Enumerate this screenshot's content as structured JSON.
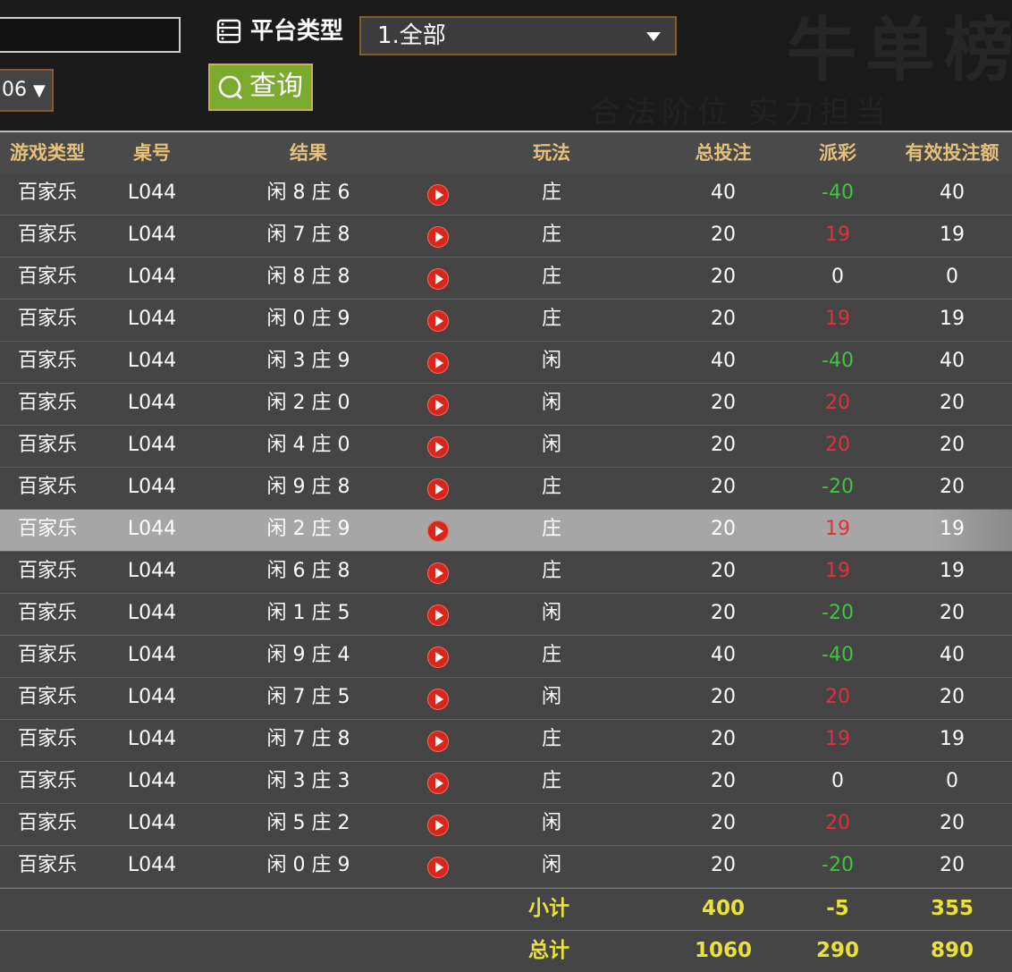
{
  "filters": {
    "date_select_value": "06",
    "platform_label": "平台类型",
    "platform_value": "1.全部",
    "query_label": "查询"
  },
  "table": {
    "headers": [
      "游戏类型",
      "桌号",
      "结果",
      "玩法",
      "总投注",
      "派彩",
      "有效投注额"
    ],
    "rows": [
      {
        "game": "百家乐",
        "table": "L044",
        "result": "闲 8 庄 6",
        "bet": "庄",
        "total": "40",
        "payout": "-40",
        "valid": "40",
        "sign": "neg"
      },
      {
        "game": "百家乐",
        "table": "L044",
        "result": "闲 7 庄 8",
        "bet": "庄",
        "total": "20",
        "payout": "19",
        "valid": "19",
        "sign": "pos"
      },
      {
        "game": "百家乐",
        "table": "L044",
        "result": "闲 8 庄 8",
        "bet": "庄",
        "total": "20",
        "payout": "0",
        "valid": "0",
        "sign": "zero"
      },
      {
        "game": "百家乐",
        "table": "L044",
        "result": "闲 0 庄 9",
        "bet": "庄",
        "total": "20",
        "payout": "19",
        "valid": "19",
        "sign": "pos"
      },
      {
        "game": "百家乐",
        "table": "L044",
        "result": "闲 3 庄 9",
        "bet": "闲",
        "total": "40",
        "payout": "-40",
        "valid": "40",
        "sign": "neg"
      },
      {
        "game": "百家乐",
        "table": "L044",
        "result": "闲 2 庄 0",
        "bet": "闲",
        "total": "20",
        "payout": "20",
        "valid": "20",
        "sign": "pos"
      },
      {
        "game": "百家乐",
        "table": "L044",
        "result": "闲 4 庄 0",
        "bet": "闲",
        "total": "20",
        "payout": "20",
        "valid": "20",
        "sign": "pos"
      },
      {
        "game": "百家乐",
        "table": "L044",
        "result": "闲 9 庄 8",
        "bet": "庄",
        "total": "20",
        "payout": "-20",
        "valid": "20",
        "sign": "neg"
      },
      {
        "game": "百家乐",
        "table": "L044",
        "result": "闲 2 庄 9",
        "bet": "庄",
        "total": "20",
        "payout": "19",
        "valid": "19",
        "sign": "pos",
        "highlight": true
      },
      {
        "game": "百家乐",
        "table": "L044",
        "result": "闲 6 庄 8",
        "bet": "庄",
        "total": "20",
        "payout": "19",
        "valid": "19",
        "sign": "pos"
      },
      {
        "game": "百家乐",
        "table": "L044",
        "result": "闲 1 庄 5",
        "bet": "闲",
        "total": "20",
        "payout": "-20",
        "valid": "20",
        "sign": "neg"
      },
      {
        "game": "百家乐",
        "table": "L044",
        "result": "闲 9 庄 4",
        "bet": "庄",
        "total": "40",
        "payout": "-40",
        "valid": "40",
        "sign": "neg"
      },
      {
        "game": "百家乐",
        "table": "L044",
        "result": "闲 7 庄 5",
        "bet": "闲",
        "total": "20",
        "payout": "20",
        "valid": "20",
        "sign": "pos"
      },
      {
        "game": "百家乐",
        "table": "L044",
        "result": "闲 7 庄 8",
        "bet": "庄",
        "total": "20",
        "payout": "19",
        "valid": "19",
        "sign": "pos"
      },
      {
        "game": "百家乐",
        "table": "L044",
        "result": "闲 3 庄 3",
        "bet": "庄",
        "total": "20",
        "payout": "0",
        "valid": "0",
        "sign": "zero"
      },
      {
        "game": "百家乐",
        "table": "L044",
        "result": "闲 5 庄 2",
        "bet": "闲",
        "total": "20",
        "payout": "20",
        "valid": "20",
        "sign": "pos"
      },
      {
        "game": "百家乐",
        "table": "L044",
        "result": "闲 0 庄 9",
        "bet": "闲",
        "total": "20",
        "payout": "-20",
        "valid": "20",
        "sign": "neg"
      }
    ],
    "subtotal": {
      "label": "小计",
      "total": "400",
      "payout": "-5",
      "valid": "355"
    },
    "grandtotal": {
      "label": "总计",
      "total": "1060",
      "payout": "290",
      "valid": "890"
    }
  },
  "colors": {
    "header_text": "#e6c07a",
    "payout_positive": "#e0313a",
    "payout_negative": "#3fc43f",
    "summary_text": "#e8e23a",
    "query_button": "#7aab2f"
  },
  "icons": {
    "platform": "server-list-icon",
    "query": "search-icon",
    "row_action": "play-video-icon"
  }
}
